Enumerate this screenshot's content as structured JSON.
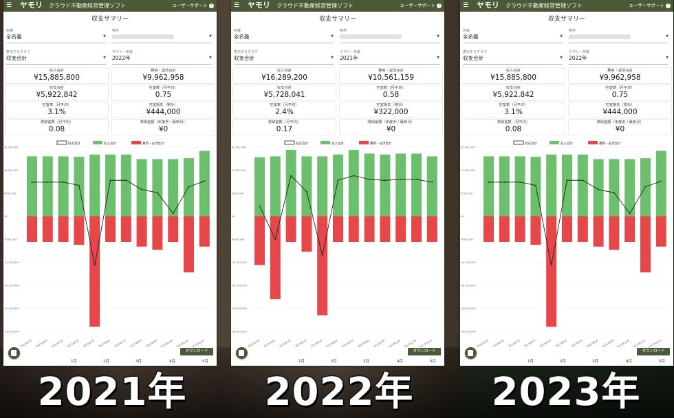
{
  "app": {
    "logo": "ヤモリ",
    "title": "クラウド不動産経営管理ソフト",
    "support": "ユーザーサポート"
  },
  "panels": [
    {
      "summary_title": "収支サマリー",
      "name_label": "名義",
      "name_value": "全名義",
      "property_label": "物件",
      "graph_label": "表示するグラフ",
      "graph_value": "収支合計",
      "year_label": "サマリー年度",
      "year_value": "2022年",
      "cards": [
        {
          "label": "収入合計",
          "value": "¥15,885,800"
        },
        {
          "label": "費用・返済合計",
          "value": "¥9,962,958"
        },
        {
          "label": "収支合計",
          "value": "¥5,922,842"
        },
        {
          "label": "空室数（月平均）",
          "value": "0.75"
        },
        {
          "label": "空室率（月平均）",
          "value": "3.1%"
        },
        {
          "label": "空室損失（累計）",
          "value": "¥444,000"
        },
        {
          "label": "滞納室数（月平均）",
          "value": "0.08"
        },
        {
          "label": "滞納金額（年度末 / 最新月）",
          "value": "¥0"
        }
      ],
      "big_year": "2021年"
    },
    {
      "summary_title": "収支サマリー",
      "name_label": "名義",
      "name_value": "全名義",
      "property_label": "物件",
      "graph_label": "表示するグラフ",
      "graph_value": "収支合計",
      "year_label": "サマリー年度",
      "year_value": "2021年",
      "cards": [
        {
          "label": "収入合計",
          "value": "¥16,289,200"
        },
        {
          "label": "費用・返済合計",
          "value": "¥10,561,159"
        },
        {
          "label": "収支合計",
          "value": "¥5,728,041"
        },
        {
          "label": "空室数（月平均）",
          "value": "0.58"
        },
        {
          "label": "空室率（月平均）",
          "value": "2.4%"
        },
        {
          "label": "空室損失（累計）",
          "value": "¥322,000"
        },
        {
          "label": "滞納室数（月平均）",
          "value": "0.17"
        },
        {
          "label": "滞納金額（年度末 / 最新月）",
          "value": "¥0"
        }
      ],
      "big_year": "2022年"
    },
    {
      "summary_title": "収支サマリー",
      "name_label": "名義",
      "name_value": "全名義",
      "property_label": "物件",
      "graph_label": "表示するグラフ",
      "graph_value": "収支合計",
      "year_label": "サマリー年度",
      "year_value": "2022年",
      "cards": [
        {
          "label": "収入合計",
          "value": "¥15,885,800"
        },
        {
          "label": "費用・返済合計",
          "value": "¥9,962,958"
        },
        {
          "label": "収支合計",
          "value": "¥5,922,842"
        },
        {
          "label": "空室数（月平均）",
          "value": "0.75"
        },
        {
          "label": "空室率（月平均）",
          "value": "3.1%"
        },
        {
          "label": "空室損失（累計）",
          "value": "¥444,000"
        },
        {
          "label": "滞納室数（月平均）",
          "value": "0.08"
        },
        {
          "label": "滞納金額（年度末 / 最新月）",
          "value": "¥0"
        }
      ],
      "big_year": "2023年"
    }
  ],
  "chart_legend": [
    "収支合計",
    "収入合計",
    "費用・返済合計"
  ],
  "chart_colors": {
    "income": "#6cbf6c",
    "expense": "#e5474b",
    "net": "#222222"
  },
  "download_label": "ダウンロード",
  "month_axis": [
    "1月",
    "2月",
    "3月",
    "4月",
    "5月"
  ],
  "chart_data": [
    {
      "type": "bar",
      "yticks": [
        "¥1,500,000",
        "¥1,000,000",
        "¥500,000",
        "¥0",
        "-¥500,000",
        "-¥1,000,000",
        "-¥1,500,000",
        "-¥2,000,000",
        "-¥2,500,000"
      ],
      "ylim": [
        -2500000,
        1500000
      ],
      "categories": [
        "2021年1月",
        "2021年2月",
        "2021年3月",
        "2021年4月",
        "2021年5月",
        "2021年6月",
        "2021年7月",
        "2021年8月",
        "2021年9月",
        "2021年10月",
        "2021年11月",
        "2021年12月"
      ],
      "series": [
        {
          "name": "収入合計",
          "values": [
            1300000,
            1300000,
            1300000,
            1290000,
            1340000,
            1340000,
            1340000,
            1240000,
            1240000,
            1240000,
            1260000,
            1420000
          ]
        },
        {
          "name": "費用・返済合計",
          "values": [
            -560000,
            -560000,
            -560000,
            -620000,
            -2400000,
            -560000,
            -560000,
            -660000,
            -730000,
            -560000,
            -1220000,
            -660000
          ]
        },
        {
          "name": "収支合計",
          "values": [
            740000,
            740000,
            740000,
            670000,
            -1060000,
            780000,
            780000,
            580000,
            510000,
            60000,
            640000,
            760000
          ]
        }
      ]
    },
    {
      "type": "bar",
      "yticks": [
        "¥1,500,000",
        "¥1,000,000",
        "¥500,000",
        "¥0",
        "-¥500,000",
        "-¥1,000,000",
        "-¥1,500,000",
        "-¥2,000,000",
        "-¥2,500,000"
      ],
      "ylim": [
        -2500000,
        1500000
      ],
      "categories": [
        "2021年1月",
        "2021年2月",
        "2021年3月",
        "2021年4月",
        "2021年5月",
        "2021年6月",
        "2021年7月",
        "2021年8月",
        "2021年9月",
        "2021年10月",
        "2021年11月",
        "2021年12月"
      ],
      "series": [
        {
          "name": "収入合計",
          "values": [
            1280000,
            1300000,
            1440000,
            1300000,
            1300000,
            1340000,
            1440000,
            1360000,
            1340000,
            1360000,
            1360000,
            1300000
          ]
        },
        {
          "name": "費用・返済合計",
          "values": [
            -1060000,
            -1800000,
            -560000,
            -770000,
            -2150000,
            -560000,
            -560000,
            -560000,
            -560000,
            -560000,
            -560000,
            -560000
          ]
        },
        {
          "name": "収支合計",
          "values": [
            220000,
            -500000,
            880000,
            530000,
            -850000,
            780000,
            880000,
            800000,
            780000,
            800000,
            800000,
            740000
          ]
        }
      ]
    },
    {
      "type": "bar",
      "yticks": [
        "¥1,500,000",
        "¥1,000,000",
        "¥500,000",
        "¥0",
        "-¥500,000",
        "-¥1,000,000",
        "-¥1,500,000",
        "-¥2,000,000",
        "-¥2,500,000"
      ],
      "ylim": [
        -2500000,
        1500000
      ],
      "categories": [
        "2021年1月",
        "2021年2月",
        "2021年3月",
        "2021年4月",
        "2021年5月",
        "2021年6月",
        "2021年7月",
        "2021年8月",
        "2021年9月",
        "2021年10月",
        "2021年11月",
        "2021年12月"
      ],
      "series": [
        {
          "name": "収入合計",
          "values": [
            1300000,
            1300000,
            1300000,
            1290000,
            1340000,
            1340000,
            1340000,
            1240000,
            1240000,
            1240000,
            1260000,
            1420000
          ]
        },
        {
          "name": "費用・返済合計",
          "values": [
            -560000,
            -560000,
            -560000,
            -620000,
            -2400000,
            -560000,
            -560000,
            -660000,
            -730000,
            -560000,
            -1220000,
            -660000
          ]
        },
        {
          "name": "収支合計",
          "values": [
            740000,
            740000,
            740000,
            670000,
            -1060000,
            780000,
            780000,
            580000,
            510000,
            60000,
            640000,
            760000
          ]
        }
      ]
    }
  ]
}
